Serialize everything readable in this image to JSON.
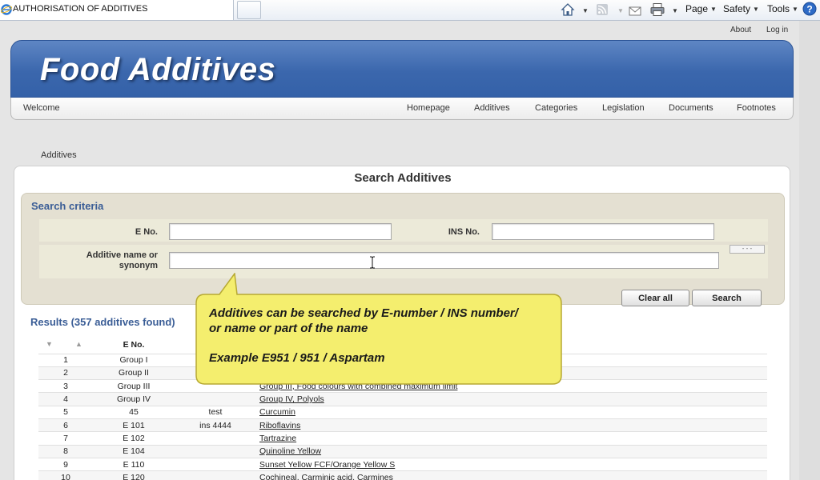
{
  "browser": {
    "tab_title": "AUTHORISATION OF ADDITIVES",
    "menus": {
      "page": "Page",
      "safety": "Safety",
      "tools": "Tools"
    }
  },
  "top_links": {
    "about": "About",
    "login": "Log in"
  },
  "header": {
    "title": "Food Additives"
  },
  "nav": {
    "welcome": "Welcome",
    "items": [
      "Homepage",
      "Additives",
      "Categories",
      "Legislation",
      "Documents",
      "Footnotes"
    ]
  },
  "breadcrumb": "Additives",
  "panel_title": "Search Additives",
  "search": {
    "title": "Search criteria",
    "e_no_label": "E No.",
    "e_no_value": "",
    "ins_no_label": "INS No.",
    "ins_no_value": "",
    "name_label": "Additive name or synonym",
    "name_value": "",
    "clear_label": "Clear all",
    "search_label": "Search"
  },
  "results": {
    "heading": "Results (357 additives found)",
    "columns": {
      "num": "",
      "e_no": "E No.",
      "ins_no": "",
      "name": ""
    },
    "rows": [
      {
        "n": "1",
        "e": "Group I",
        "ins": "",
        "name": ""
      },
      {
        "n": "2",
        "e": "Group II",
        "ins": "",
        "name": ""
      },
      {
        "n": "3",
        "e": "Group III",
        "ins": "",
        "name": "Group III, Food colours with combined maximum limit"
      },
      {
        "n": "4",
        "e": "Group IV",
        "ins": "",
        "name": "Group IV, Polyols"
      },
      {
        "n": "5",
        "e": "45",
        "ins": "test",
        "name": "Curcumin"
      },
      {
        "n": "6",
        "e": "E 101",
        "ins": "ins 4444",
        "name": "Riboflavins"
      },
      {
        "n": "7",
        "e": "E 102",
        "ins": "",
        "name": "Tartrazine"
      },
      {
        "n": "8",
        "e": "E 104",
        "ins": "",
        "name": "Quinoline Yellow"
      },
      {
        "n": "9",
        "e": "E 110",
        "ins": "",
        "name": "Sunset Yellow FCF/Orange Yellow S"
      },
      {
        "n": "10",
        "e": "E 120",
        "ins": "",
        "name": "Cochineal, Carminic acid, Carmines"
      }
    ]
  },
  "callout": {
    "line1": "Additives can be searched by E-number / INS number/",
    "line2": "or name or part of the name",
    "line3": "Example E951 / 951 / Aspartam"
  },
  "colors": {
    "header_blue": "#3b67ad",
    "link_blue": "#3a5d96",
    "callout_yellow": "#f4ee6e"
  }
}
